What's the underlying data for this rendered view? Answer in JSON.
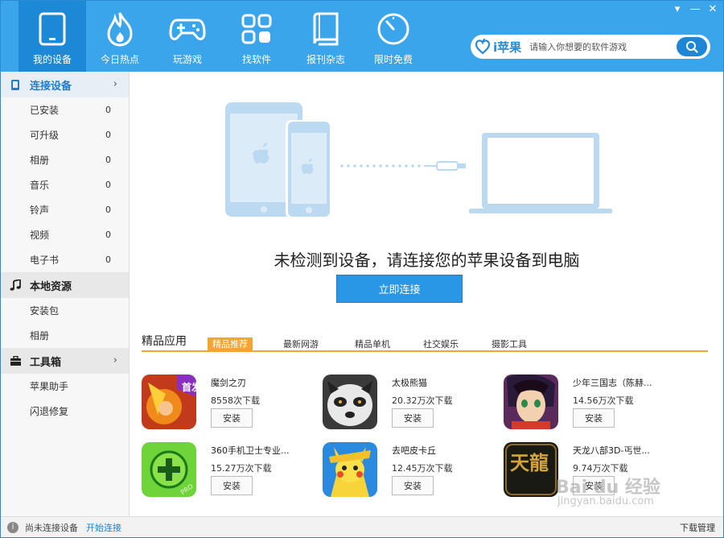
{
  "window_controls": {
    "menu": "▾",
    "minimize": "—",
    "close": "✕"
  },
  "nav_tabs": [
    {
      "label": "我的设备",
      "icon": "tablet-icon"
    },
    {
      "label": "今日热点",
      "icon": "flame-icon"
    },
    {
      "label": "玩游戏",
      "icon": "gamepad-icon"
    },
    {
      "label": "找软件",
      "icon": "apps-grid-icon"
    },
    {
      "label": "报刊杂志",
      "icon": "book-icon"
    },
    {
      "label": "限时免费",
      "icon": "timer-icon"
    }
  ],
  "search": {
    "brand": "i苹果",
    "placeholder": "请输入你想要的软件游戏"
  },
  "sidebar": {
    "connect_header": "连接设备",
    "device_items": [
      {
        "label": "已安装",
        "count": "0"
      },
      {
        "label": "可升级",
        "count": "0"
      },
      {
        "label": "相册",
        "count": "0"
      },
      {
        "label": "音乐",
        "count": "0"
      },
      {
        "label": "铃声",
        "count": "0"
      },
      {
        "label": "视频",
        "count": "0"
      },
      {
        "label": "电子书",
        "count": "0"
      }
    ],
    "local_header": "本地资源",
    "local_items": [
      {
        "label": "安装包"
      },
      {
        "label": "相册"
      }
    ],
    "tools_header": "工具箱",
    "tool_items": [
      {
        "label": "苹果助手"
      },
      {
        "label": "闪退修复"
      }
    ],
    "chevron": "›"
  },
  "main": {
    "notice": "未检测到设备，请连接您的苹果设备到电脑",
    "connect_button": "立即连接"
  },
  "recommend": {
    "title": "精品应用",
    "tabs": [
      "精品推荐",
      "最新网游",
      "精品单机",
      "社交娱乐",
      "摄影工具"
    ],
    "active_tab": 0,
    "install_label": "安装",
    "apps": [
      {
        "name": "魔剑之刃",
        "downloads": "8558次下载",
        "badge": "首发"
      },
      {
        "name": "太极熊猫",
        "downloads": "20.32万次下载"
      },
      {
        "name": "少年三国志（陈赫...",
        "downloads": "14.56万次下载"
      },
      {
        "name": "360手机卫士专业...",
        "downloads": "15.27万次下载",
        "badge": "PRO"
      },
      {
        "name": "去吧皮卡丘",
        "downloads": "12.45万次下载"
      },
      {
        "name": "天龙八部3D-丐世...",
        "downloads": "9.74万次下载",
        "badge": "天龍"
      }
    ]
  },
  "statusbar": {
    "info": "i",
    "status": "尚未连接设备",
    "link": "开始连接",
    "download_manager": "下载管理"
  },
  "watermark": {
    "text": "Bai du 经验",
    "sub": "jingyan.baidu.com"
  },
  "colors": {
    "accent": "#3aa5ea",
    "active_nav": "#1d88d6",
    "orange": "#f4a531",
    "illustration": "#bcd9f2"
  }
}
